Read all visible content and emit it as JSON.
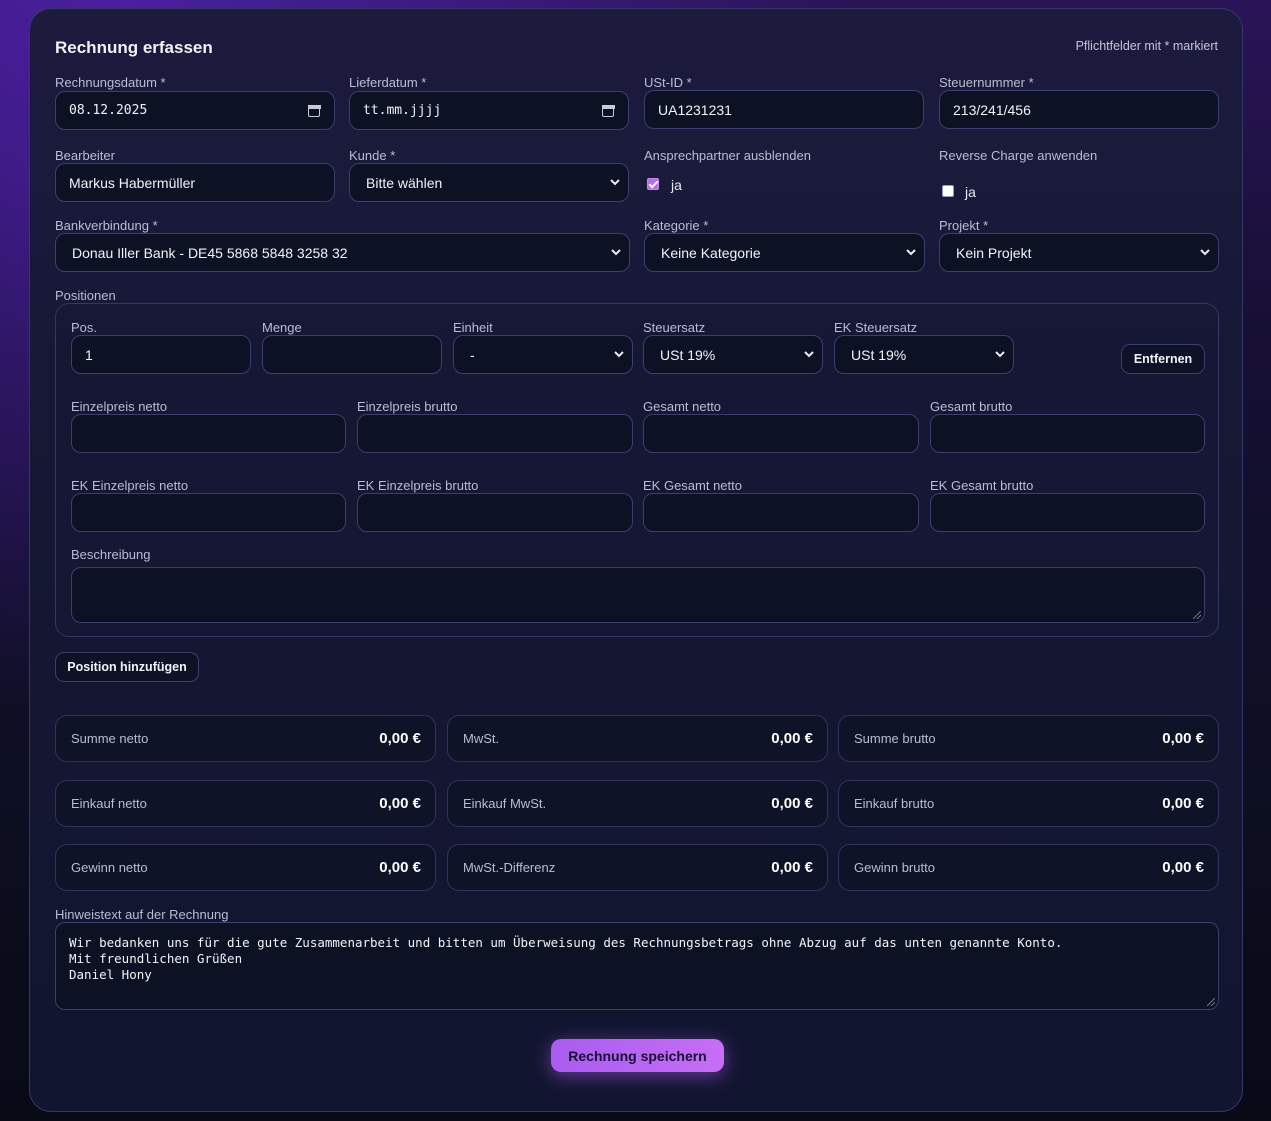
{
  "form": {
    "title": "Rechnung erfassen",
    "required_hint": "Pflichtfelder mit * markiert"
  },
  "fields": {
    "rechnungsdatum": {
      "label": "Rechnungsdatum *",
      "value": "08.12.2025",
      "icon": "calendar-icon"
    },
    "lieferdatum": {
      "label": "Lieferdatum *",
      "value": "tt.mm.jjjj",
      "icon": "calendar-icon"
    },
    "ust_id": {
      "label": "USt-ID *",
      "value": "UA1231231"
    },
    "steuernummer": {
      "label": "Steuernummer *",
      "value": "213/241/456"
    },
    "bearbeiter": {
      "label": "Bearbeiter",
      "value": "Markus Habermüller"
    },
    "kunde": {
      "label": "Kunde *",
      "value": "Bitte wählen"
    },
    "ansprechpartner": {
      "label": "Ansprechpartner ausblenden",
      "option": "ja",
      "checked": true
    },
    "reverse_charge": {
      "label": "Reverse Charge anwenden",
      "option": "ja",
      "checked": false
    },
    "bankverbindung": {
      "label": "Bankverbindung *",
      "value": "Donau Iller Bank - DE45 5868 5848 3258 32"
    },
    "kategorie": {
      "label": "Kategorie *",
      "value": "Keine Kategorie"
    },
    "projekt": {
      "label": "Projekt *",
      "value": "Kein Projekt"
    }
  },
  "positionen": {
    "label": "Positionen",
    "pos": {
      "label": "Pos.",
      "value": "1"
    },
    "menge": {
      "label": "Menge",
      "value": ""
    },
    "einheit": {
      "label": "Einheit",
      "value": "-"
    },
    "steuersatz": {
      "label": "Steuersatz",
      "value": "USt 19%"
    },
    "ek_steuersatz": {
      "label": "EK Steuersatz",
      "value": "USt 19%"
    },
    "remove_label": "Entfernen",
    "einzelpreis_netto": "Einzelpreis netto",
    "einzelpreis_brutto": "Einzelpreis brutto",
    "gesamt_netto": "Gesamt netto",
    "gesamt_brutto": "Gesamt brutto",
    "ek_einzelpreis_netto": "EK Einzelpreis netto",
    "ek_einzelpreis_brutto": "EK Einzelpreis brutto",
    "ek_gesamt_netto": "EK Gesamt netto",
    "ek_gesamt_brutto": "EK Gesamt brutto",
    "beschreibung": "Beschreibung",
    "add_label": "Position hinzufügen"
  },
  "summary": [
    {
      "label": "Summe netto",
      "value": "0,00 €"
    },
    {
      "label": "MwSt.",
      "value": "0,00 €"
    },
    {
      "label": "Summe brutto",
      "value": "0,00 €"
    },
    {
      "label": "Einkauf netto",
      "value": "0,00 €"
    },
    {
      "label": "Einkauf MwSt.",
      "value": "0,00 €"
    },
    {
      "label": "Einkauf brutto",
      "value": "0,00 €"
    },
    {
      "label": "Gewinn netto",
      "value": "0,00 €"
    },
    {
      "label": "MwSt.-Differenz",
      "value": "0,00 €"
    },
    {
      "label": "Gewinn brutto",
      "value": "0,00 €"
    }
  ],
  "hinweis": {
    "label": "Hinweistext auf der Rechnung",
    "value": "Wir bedanken uns für die gute Zusammenarbeit und bitten um Überweisung des Rechnungsbetrags ohne Abzug auf das unten genannte Konto.\nMit freundlichen Grüßen\nDaniel Hony"
  },
  "save_label": "Rechnung speichern",
  "colors": {
    "accent": "#b86ae8",
    "background": "#0d0f22",
    "card": "#151733"
  }
}
